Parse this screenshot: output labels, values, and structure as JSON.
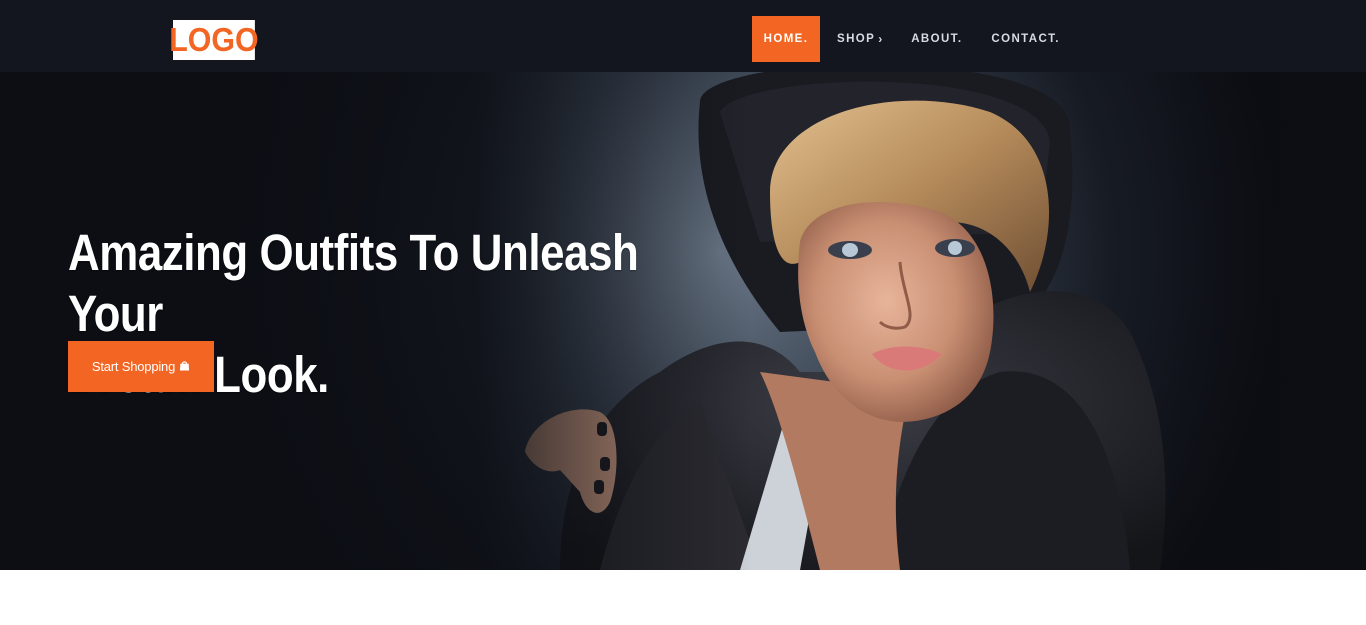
{
  "header": {
    "logo_text": "LOGO",
    "nav": [
      {
        "label": "HOME.",
        "active": true
      },
      {
        "label": "SHOP",
        "has_submenu": true
      },
      {
        "label": "ABOUT."
      },
      {
        "label": "CONTACT."
      }
    ],
    "shop_submenu_icon": "chevron-right-icon"
  },
  "hero": {
    "headline_line1": "Amazing Outfits To Unleash Your",
    "headline_line2": "Dream Look.",
    "cta_label": "Start Shopping",
    "cta_icon": "shopping-bag-icon",
    "image": "fashion-model-photo"
  },
  "colors": {
    "accent": "#f26522",
    "header_bg": "#13161e",
    "hero_bg": "#0d0f15",
    "text_light": "#ffffff",
    "nav_text": "#d8dbe2"
  }
}
